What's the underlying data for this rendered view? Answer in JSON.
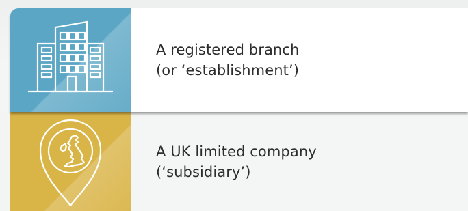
{
  "options": [
    {
      "icon": "office-building-icon",
      "line1": "A registered branch",
      "line2": "(or ‘establishment’)",
      "tile_color": "#5aa6c4",
      "panel_color": "#ffffff"
    },
    {
      "icon": "uk-map-location-pin-icon",
      "line1": "A UK limited company",
      "line2": "(‘subsidiary’)",
      "tile_color": "#d9b447",
      "panel_color": "#f4f5f5"
    }
  ]
}
